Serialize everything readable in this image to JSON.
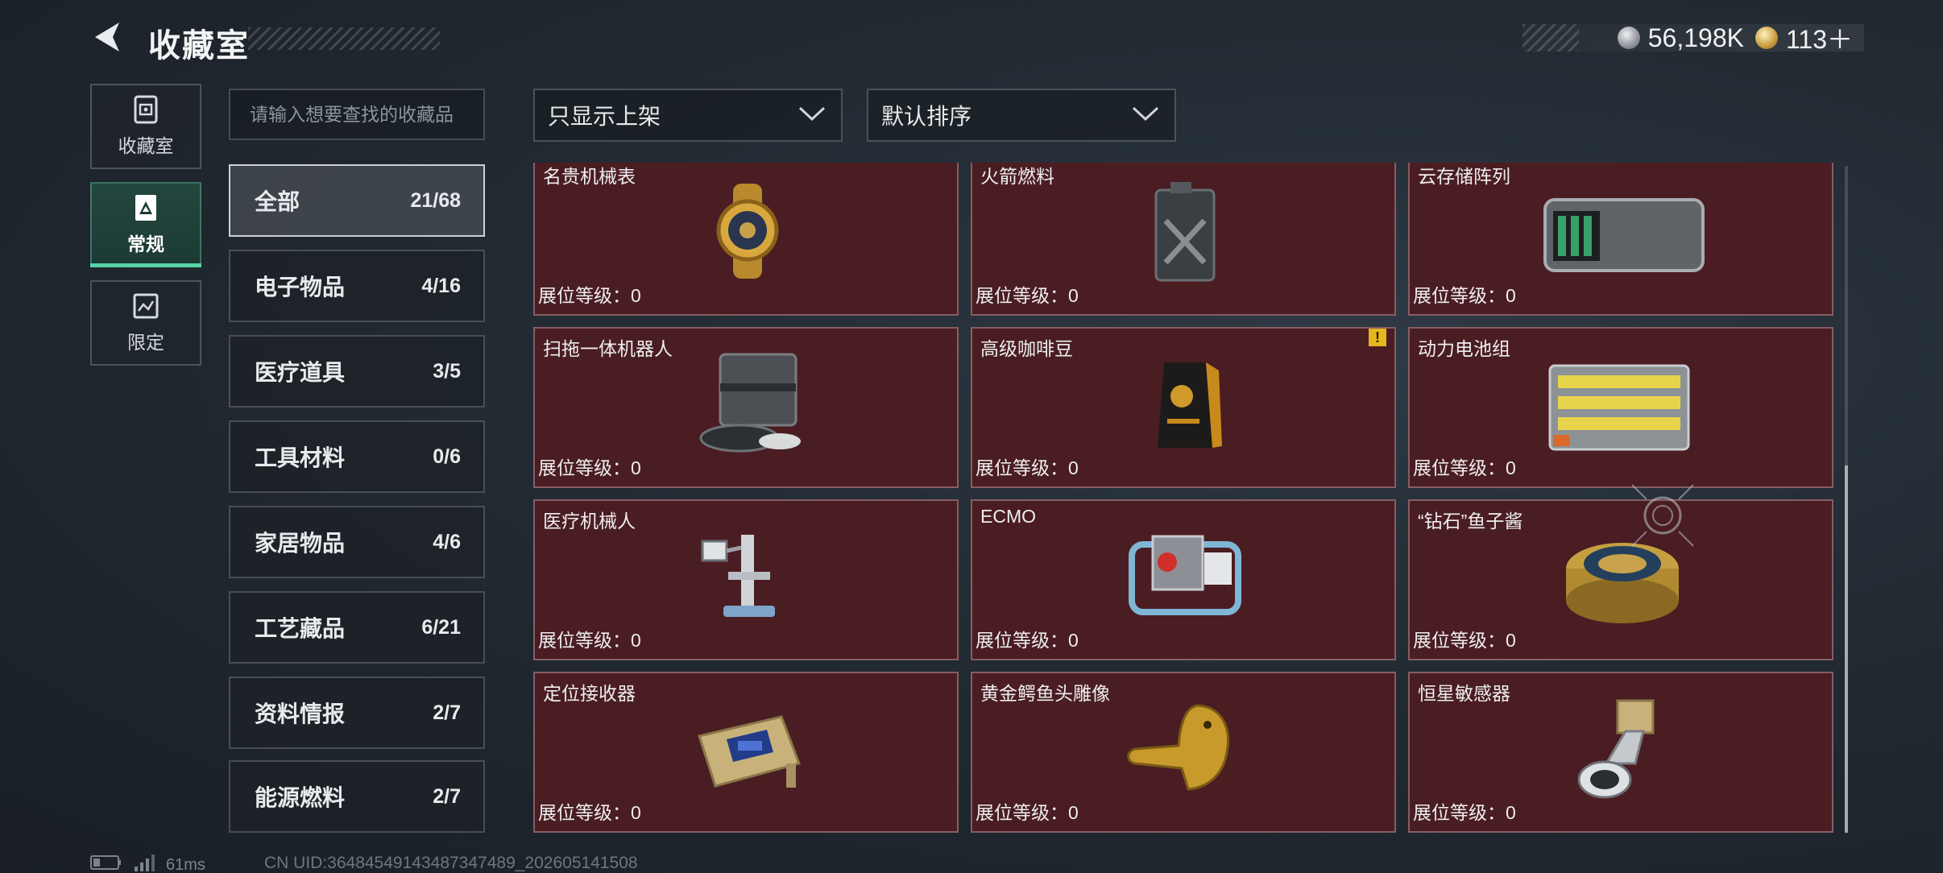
{
  "header": {
    "title": "收藏室"
  },
  "currency": [
    {
      "icon": "silver-coin-icon",
      "amount": "56,198K"
    },
    {
      "icon": "gold-coin-icon",
      "amount": "113＋"
    }
  ],
  "left_nav": [
    {
      "label": "收藏室",
      "icon": "display-case-icon",
      "active": false
    },
    {
      "label": "常规",
      "icon": "collection-card-icon",
      "active": true
    },
    {
      "label": "限定",
      "icon": "limited-map-icon",
      "active": false
    }
  ],
  "search": {
    "placeholder": "请输入想要查找的收藏品",
    "value": ""
  },
  "filters": {
    "availability": "只显示上架",
    "sort": "默认排序"
  },
  "categories": [
    {
      "label": "全部",
      "count": "21/68",
      "active": true
    },
    {
      "label": "电子物品",
      "count": "4/16",
      "active": false
    },
    {
      "label": "医疗道具",
      "count": "3/5",
      "active": false
    },
    {
      "label": "工具材料",
      "count": "0/6",
      "active": false
    },
    {
      "label": "家居物品",
      "count": "4/6",
      "active": false
    },
    {
      "label": "工艺藏品",
      "count": "6/21",
      "active": false
    },
    {
      "label": "资料情报",
      "count": "2/7",
      "active": false
    },
    {
      "label": "能源燃料",
      "count": "2/7",
      "active": false
    }
  ],
  "items": [
    {
      "name": "名贵机械表",
      "level": "展位等级：0",
      "icon": "luxury-watch-icon"
    },
    {
      "name": "火箭燃料",
      "level": "展位等级：0",
      "icon": "fuel-canister-icon"
    },
    {
      "name": "云存储阵列",
      "level": "展位等级：0",
      "icon": "storage-array-icon"
    },
    {
      "name": "扫拖一体机器人",
      "level": "展位等级：0",
      "icon": "robot-vacuum-icon"
    },
    {
      "name": "高级咖啡豆",
      "level": "展位等级：0",
      "icon": "coffee-bag-icon",
      "badge": "!"
    },
    {
      "name": "动力电池组",
      "level": "展位等级：0",
      "icon": "battery-pack-icon"
    },
    {
      "name": "医疗机械人",
      "level": "展位等级：0",
      "icon": "medical-robot-icon"
    },
    {
      "name": "ECMO",
      "level": "展位等级：0",
      "icon": "ecmo-machine-icon"
    },
    {
      "name": "“钻石”鱼子酱",
      "level": "展位等级：0",
      "icon": "caviar-tin-icon"
    },
    {
      "name": "定位接收器",
      "level": "展位等级：0",
      "icon": "gps-receiver-icon"
    },
    {
      "name": "黄金鳄鱼头雕像",
      "level": "展位等级：0",
      "icon": "gold-crocodile-statue-icon"
    },
    {
      "name": "恒星敏感器",
      "level": "展位等级：0",
      "icon": "star-sensor-icon"
    }
  ],
  "footer": {
    "ping": "61ms",
    "uid": "CN UID:36484549143487347489_202605141508"
  },
  "colors": {
    "accent": "#55d3a6",
    "card_bg": "#4a1d23",
    "badge": "#e6b61e"
  }
}
